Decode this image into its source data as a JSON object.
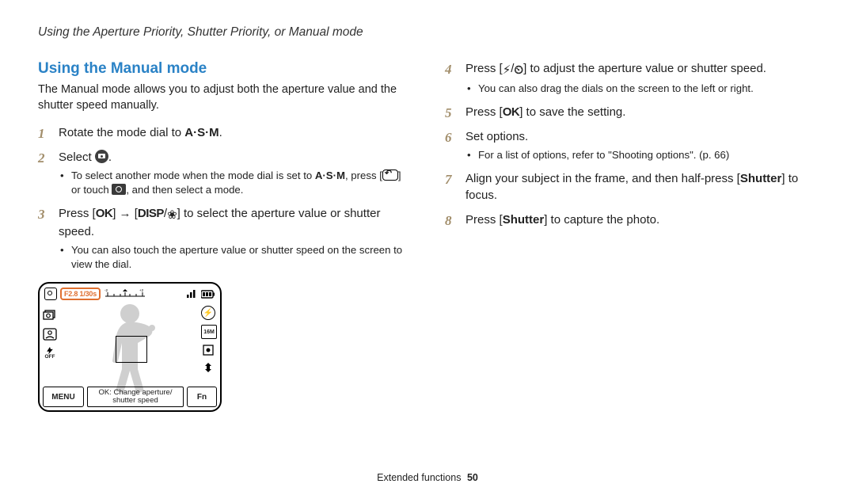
{
  "header": "Using the Aperture Priority, Shutter Priority, or Manual mode",
  "section_title": "Using the Manual mode",
  "intro": "The Manual mode allows you to adjust both the aperture value and the shutter speed manually.",
  "left_steps": {
    "s1": {
      "pre": "Rotate the mode dial to ",
      "glyph": "A·S·M",
      "post": "."
    },
    "s2": {
      "pre": "Select ",
      "post": ".",
      "sub1_a": "To select another mode when the mode dial is set to ",
      "sub1_glyph": "A·S·M",
      "sub1_b": ", press [",
      "sub1_c": "] or touch ",
      "sub1_d": ", and then select a mode."
    },
    "s3": {
      "a": "Press [",
      "ok": "OK",
      "b": "] ",
      "arrow": "→",
      "c": " [",
      "disp": "DISP",
      "slash": "/",
      "macro": "❀",
      "d": "] to select the aperture value or shutter speed.",
      "sub1": "You can also touch the aperture value or shutter speed on the screen to view the dial."
    }
  },
  "right_steps": {
    "s4": {
      "a": "Press [",
      "flash": "⚡",
      "slash": "/",
      "timer": "⏲",
      "b": "] to adjust the aperture value or shutter speed.",
      "sub1": "You can also drag the dials on the screen to the left or right."
    },
    "s5": {
      "a": "Press [",
      "ok": "OK",
      "b": "] to save the setting."
    },
    "s6": {
      "text": "Set options.",
      "sub1": "For a list of options, refer to \"Shooting options\". (p. 66)"
    },
    "s7": {
      "a": "Align your subject in the frame, and then half-press [",
      "shutter": "Shutter",
      "b": "] to focus."
    },
    "s8": {
      "a": "Press [",
      "shutter": "Shutter",
      "b": "] to capture the photo."
    }
  },
  "lcd": {
    "readout": "F2.8 1/30s",
    "ev_minus": "-2",
    "ev_plus": "+2",
    "menu": "MENU",
    "fn": "Fn",
    "hint": "OK: Change aperture/ shutter speed",
    "res": "16M",
    "flash": "⚡",
    "off_label": "OFF"
  },
  "footer": {
    "label": "Extended functions",
    "page": "50"
  }
}
